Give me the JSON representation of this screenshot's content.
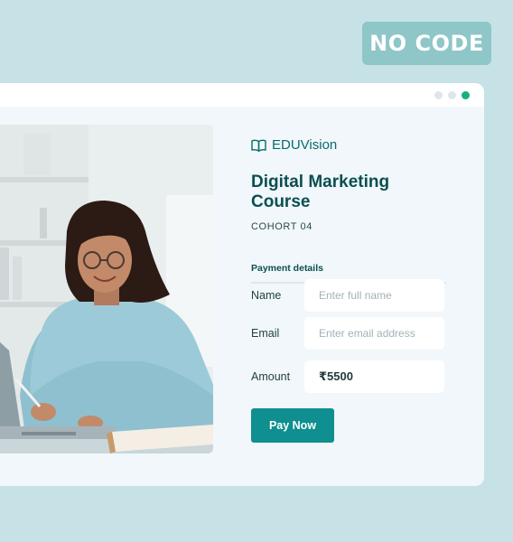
{
  "badge": {
    "label": "NO CODE"
  },
  "window": {
    "dots": [
      "inactive",
      "inactive",
      "active"
    ],
    "dot_colors": {
      "inactive": "#dfe6ea",
      "active": "#18b07b"
    }
  },
  "form": {
    "brand": "EDUVision",
    "brand_icon": "open-book-icon",
    "course_title": "Digital Marketing Course",
    "cohort": "COHORT 04",
    "section_title": "Payment details",
    "name": {
      "label": "Name",
      "placeholder": "Enter full name"
    },
    "email": {
      "label": "Email",
      "placeholder": "Enter email address"
    },
    "amount": {
      "label": "Amount",
      "value": "₹5500"
    },
    "pay_button": "Pay Now"
  },
  "colors": {
    "background": "#c6e2e7",
    "accent": "#0f8f8f",
    "heading": "#0b4f52"
  }
}
